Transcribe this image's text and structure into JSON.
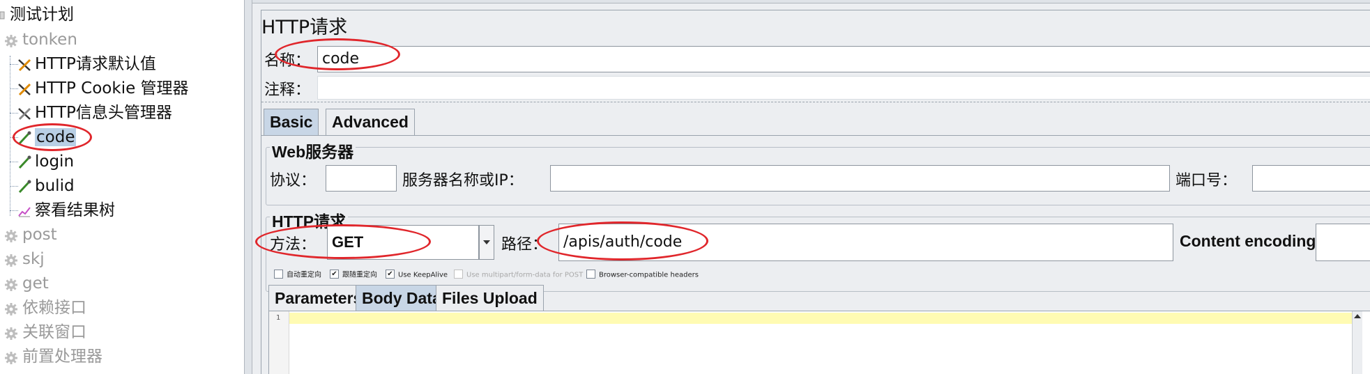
{
  "tree": {
    "items": [
      {
        "label": "测试计划",
        "icon": "testplan-icon",
        "level": 0,
        "gray": false
      },
      {
        "label": "tonken",
        "icon": "gear-icon",
        "level": 1,
        "gray": true
      },
      {
        "label": "HTTP请求默认值",
        "icon": "wrench-icon",
        "level": 2,
        "gray": false
      },
      {
        "label": "HTTP Cookie 管理器",
        "icon": "wrench-icon",
        "level": 2,
        "gray": false
      },
      {
        "label": "HTTP信息头管理器",
        "icon": "wrench-icon",
        "level": 2,
        "gray": false
      },
      {
        "label": "code",
        "icon": "pipette-icon",
        "level": 2,
        "gray": false,
        "selected": true
      },
      {
        "label": "login",
        "icon": "pipette-icon",
        "level": 2,
        "gray": false
      },
      {
        "label": "bulid",
        "icon": "pipette-icon",
        "level": 2,
        "gray": false
      },
      {
        "label": "察看结果树",
        "icon": "graph-icon",
        "level": 2,
        "gray": false
      },
      {
        "label": "post",
        "icon": "gear-icon",
        "level": 1,
        "gray": true
      },
      {
        "label": "skj",
        "icon": "gear-icon",
        "level": 1,
        "gray": true
      },
      {
        "label": "get",
        "icon": "gear-icon",
        "level": 1,
        "gray": true
      },
      {
        "label": "依赖接口",
        "icon": "gear-icon",
        "level": 1,
        "gray": true
      },
      {
        "label": "关联窗口",
        "icon": "gear-icon",
        "level": 1,
        "gray": true
      },
      {
        "label": "前置处理器",
        "icon": "gear-icon",
        "level": 1,
        "gray": true
      }
    ]
  },
  "panel": {
    "title": "HTTP请求",
    "name_label": "名称：",
    "name_value": "code",
    "comment_label": "注释：",
    "comment_value": "",
    "tabs": [
      "Basic",
      "Advanced"
    ],
    "web_server": {
      "group_title": "Web服务器",
      "protocol_label": "协议：",
      "protocol_value": "",
      "server_label": "服务器名称或IP：",
      "server_value": "",
      "port_label": "端口号：",
      "port_value": ""
    },
    "http_request": {
      "group_title": "HTTP请求",
      "method_label": "方法：",
      "method_value": "GET",
      "path_label": "路径：",
      "path_value": "/apis/auth/code",
      "encoding_label": "Content encoding:",
      "encoding_value": ""
    },
    "checkboxes": [
      {
        "label": "自动重定向",
        "checked": false,
        "disabled": false
      },
      {
        "label": "跟随重定向",
        "checked": true,
        "disabled": false
      },
      {
        "label": "Use KeepAlive",
        "checked": true,
        "disabled": false
      },
      {
        "label": "Use multipart/form-data for POST",
        "checked": false,
        "disabled": true
      },
      {
        "label": "Browser-compatible headers",
        "checked": false,
        "disabled": false
      }
    ],
    "body_tabs": [
      "Parameters",
      "Body Data",
      "Files Upload"
    ],
    "body_tab_active": "Body Data",
    "editor_line_number": "1"
  },
  "colors": {
    "highlight_ellipse": "#e0262b",
    "selection": "#b8cfe5",
    "editor_current_line": "#fffbb3"
  }
}
